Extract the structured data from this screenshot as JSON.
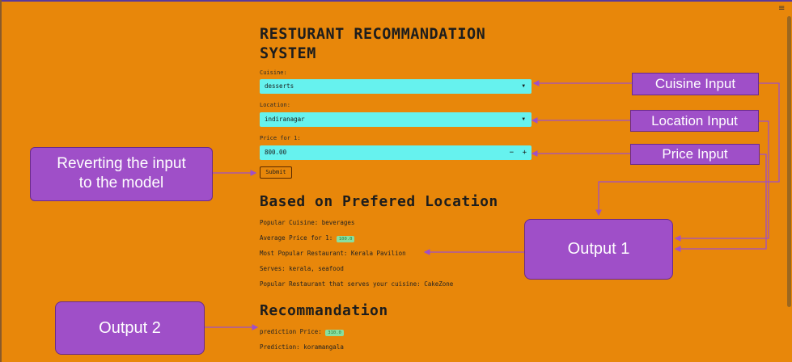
{
  "app": {
    "title": "RESTURANT RECOMMANDATION SYSTEM",
    "menu_icon": "hamburger-menu-icon"
  },
  "form": {
    "cuisine_label": "Cuisine:",
    "cuisine_value": "desserts",
    "location_label": "Location:",
    "location_value": "indiranagar",
    "price_label": "Price for 1:",
    "price_value": "800.00",
    "minus": "−",
    "plus": "+",
    "submit_label": "Submit"
  },
  "location_section": {
    "heading": "Based on Prefered Location",
    "popular_cuisine": "Popular Cuisine: beverages",
    "avg_price_label": "Average Price for 1:",
    "avg_price_value": "100.0",
    "most_popular": "Most Popular Restaurant: Kerala Pavilion",
    "serves": "Serves: kerala, seafood",
    "popular_serving": "Popular Restaurant that serves your cuisine: CakeZone"
  },
  "recommendation": {
    "heading": "Recommandation",
    "price_label": "prediction Price:",
    "price_value": "310.0",
    "prediction": "Prediction: koramangala"
  },
  "annotations": {
    "cuisine_input": "Cuisine Input",
    "location_input": "Location Input",
    "price_input": "Price Input",
    "reverting_line1": "Reverting the input",
    "reverting_line2": "to the model",
    "output1": "Output 1",
    "output2": "Output 2",
    "arrow_color": "#9f4fc8"
  }
}
